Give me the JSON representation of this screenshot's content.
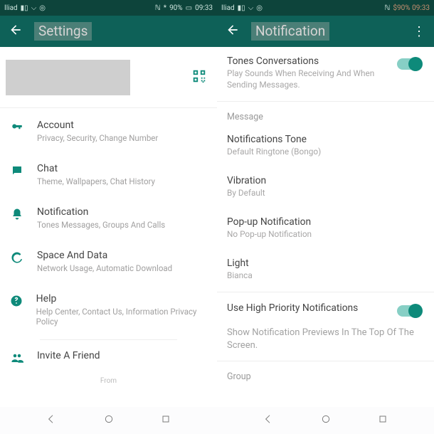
{
  "statusbar": {
    "carrier": "Iliad",
    "battery": "90%",
    "time": "09:33",
    "price": "$90% 09:33"
  },
  "left": {
    "title": "Settings",
    "items": [
      {
        "title": "Account",
        "sub": "Privacy, Security, Change Number"
      },
      {
        "title": "Chat",
        "sub": "Theme, Wallpapers, Chat History"
      },
      {
        "title": "Notification",
        "sub": "Tones Messages, Groups And Calls"
      },
      {
        "title": "Space And Data",
        "sub": "Network Usage, Automatic Download"
      },
      {
        "title": "Help",
        "sub": "Help Center, Contact Us, Information Privacy Policy"
      },
      {
        "title": "Invite A Friend",
        "sub": ""
      }
    ],
    "from": "From"
  },
  "right": {
    "title": "Notification",
    "tones": {
      "title": "Tones Conversations",
      "sub": "Play Sounds When Receiving And When Sending Messages."
    },
    "section_message": "Message",
    "rows": [
      {
        "title": "Notifications Tone",
        "sub": "Default Ringtone (Bongo)"
      },
      {
        "title": "Vibration",
        "sub": "By Default"
      },
      {
        "title": "Pop-up Notification",
        "sub": "No Pop-up Notification"
      },
      {
        "title": "Light",
        "sub": "Bianca"
      }
    ],
    "priority": {
      "title": "Use High Priority Notifications",
      "sub": "Show Notification Previews In The Top Of The Screen."
    },
    "section_group": "Group"
  }
}
